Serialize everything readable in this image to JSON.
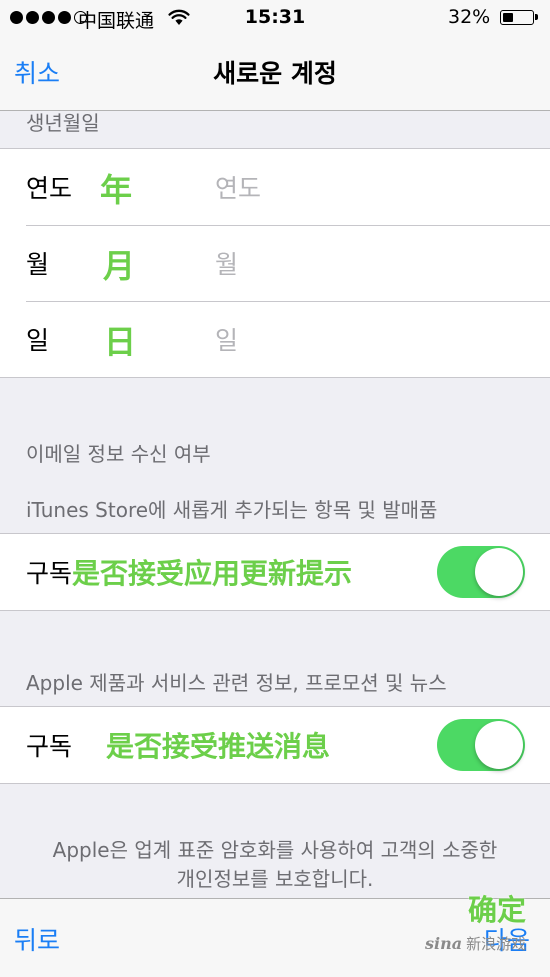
{
  "status_bar": {
    "carrier": "中国联通",
    "time": "15:31",
    "battery_percent": "32%",
    "battery_level": 0.32,
    "signal_bars_filled": 4,
    "signal_bars_total": 5
  },
  "nav": {
    "cancel": "취소",
    "title": "새로운 계정"
  },
  "birthdate": {
    "header": "생년월일",
    "rows": [
      {
        "label": "연도",
        "annotation": "年",
        "placeholder": "연도"
      },
      {
        "label": "월",
        "annotation": "月",
        "placeholder": "월"
      },
      {
        "label": "일",
        "annotation": "日",
        "placeholder": "일"
      }
    ]
  },
  "email": {
    "header": "이메일 정보 수신 여부",
    "itunes": {
      "description": "iTunes Store에 새롭게 추가되는 항목 및 발매품",
      "label": "구독",
      "annotation": "是否接受应用更新提示",
      "toggle_on": true
    },
    "apple": {
      "description": "Apple 제품과 서비스 관련 정보, 프로모션 및 뉴스",
      "label": "구독",
      "annotation": "是否接受推送消息",
      "toggle_on": true
    }
  },
  "footer": {
    "line1": "Apple은 업계 표준 암호화를 사용하여 고객의 소중한",
    "line2": "개인정보를 보호합니다."
  },
  "toolbar": {
    "back": "뒤로",
    "next": "다음",
    "next_annotation": "确定"
  },
  "watermark": {
    "logo": "sina",
    "text": "新浪游戏"
  },
  "colors": {
    "accent": "#1a7ef5",
    "toggle_on": "#4cd964",
    "annotation": "#6ccf4a",
    "background": "#efeff4"
  }
}
